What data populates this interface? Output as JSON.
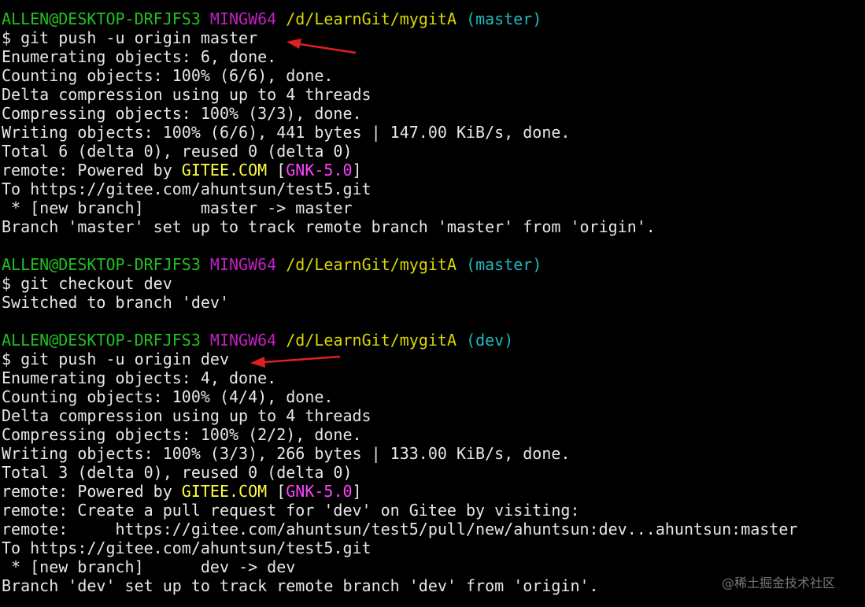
{
  "colors": {
    "background": "#000000",
    "text": "#e6e6e6",
    "user": "#20c020",
    "mingw": "#c020c0",
    "path": "#d8d800",
    "branch": "#20b8c0",
    "gitee": "#ffff40",
    "gnk": "#ff40ff",
    "arrow": "#e02020"
  },
  "session1": {
    "prompt": {
      "user": "ALLEN@DESKTOP-DRFJFS3",
      "mingw": "MINGW64",
      "path": "/d/LearnGit/mygitA",
      "branch": "(master)"
    },
    "command": "$ git push -u origin master",
    "out1": "Enumerating objects: 6, done.",
    "out2": "Counting objects: 100% (6/6), done.",
    "out3": "Delta compression using up to 4 threads",
    "out4": "Compressing objects: 100% (3/3), done.",
    "out5": "Writing objects: 100% (6/6), 441 bytes | 147.00 KiB/s, done.",
    "out6": "Total 6 (delta 0), reused 0 (delta 0)",
    "remote_prefix": "remote: Powered by ",
    "gitee": "GITEE.COM",
    "bracket_open": " [",
    "gnk": "GNK-5.0",
    "bracket_close": "]",
    "to": "To https://gitee.com/ahuntsun/test5.git",
    "new_branch": " * [new branch]      master -> master",
    "branch_set": "Branch 'master' set up to track remote branch 'master' from 'origin'."
  },
  "session2": {
    "prompt": {
      "user": "ALLEN@DESKTOP-DRFJFS3",
      "mingw": "MINGW64",
      "path": "/d/LearnGit/mygitA",
      "branch": "(master)"
    },
    "command": "$ git checkout dev",
    "out1": "Switched to branch 'dev'"
  },
  "session3": {
    "prompt": {
      "user": "ALLEN@DESKTOP-DRFJFS3",
      "mingw": "MINGW64",
      "path": "/d/LearnGit/mygitA",
      "branch": "(dev)"
    },
    "command": "$ git push -u origin dev",
    "out1": "Enumerating objects: 4, done.",
    "out2": "Counting objects: 100% (4/4), done.",
    "out3": "Delta compression using up to 4 threads",
    "out4": "Compressing objects: 100% (2/2), done.",
    "out5": "Writing objects: 100% (3/3), 266 bytes | 133.00 KiB/s, done.",
    "out6": "Total 3 (delta 0), reused 0 (delta 0)",
    "remote_prefix": "remote: Powered by ",
    "gitee": "GITEE.COM",
    "bracket_open": " [",
    "gnk": "GNK-5.0",
    "bracket_close": "]",
    "remote_pr": "remote: Create a pull request for 'dev' on Gitee by visiting:",
    "remote_url": "remote:     https://gitee.com/ahuntsun/test5/pull/new/ahuntsun:dev...ahuntsun:master",
    "to": "To https://gitee.com/ahuntsun/test5.git",
    "new_branch": " * [new branch]      dev -> dev",
    "branch_set": "Branch 'dev' set up to track remote branch 'dev' from 'origin'."
  },
  "watermark": "@稀土掘金技术社区"
}
